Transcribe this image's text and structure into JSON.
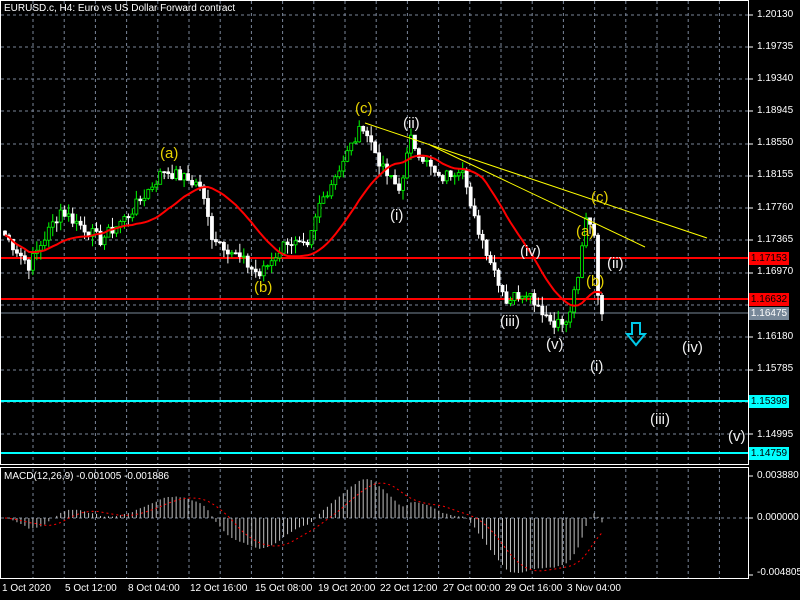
{
  "header": {
    "title": "EURUSD.c, H4:  Euro vs US Dollar Forward contract"
  },
  "price_axis": [
    "1.20130",
    "1.19735",
    "1.19340",
    "1.18945",
    "1.18550",
    "1.18155",
    "1.17760",
    "1.17365",
    "1.16970",
    "1.16180",
    "1.15785",
    "1.14995"
  ],
  "price_tags": {
    "resistance": "1.17153",
    "support1": "1.16632",
    "current": "1.16475",
    "target1": "1.15398",
    "target2": "1.14759"
  },
  "time_axis": [
    "1 Oct 2020",
    "5 Oct 12:00",
    "8 Oct 04:00",
    "12 Oct 16:00",
    "15 Oct 08:00",
    "19 Oct 20:00",
    "22 Oct 12:00",
    "27 Oct 00:00",
    "29 Oct 16:00",
    "3 Nov 04:00"
  ],
  "macd": {
    "label": "MACD(12,26,9) -0.001005 -0.001886",
    "axis": [
      "0.003880",
      "0.000000",
      "-0.004805"
    ]
  },
  "waves": {
    "a1": "(a)",
    "b1": "(b)",
    "c1": "(c)",
    "ii1": "(ii)",
    "i1": "(i)",
    "iii1": "(iii)",
    "iv1": "(iv)",
    "v1": "(v)",
    "a2": "(a)",
    "b2": "(b)",
    "c2": "(c)",
    "ii2": "(ii)",
    "i2": "(i)",
    "iv2": "(iv)",
    "iii2": "(iii)",
    "v2": "(v)"
  },
  "colors": {
    "bull": "#00ff00",
    "bear": "#ffffff",
    "ma": "#ff0000",
    "level": "#ff0000",
    "target": "#00ffff",
    "trend": "#ffff00"
  },
  "chart_data": {
    "type": "candlestick",
    "symbol": "EURUSD.c",
    "timeframe": "H4",
    "ylim": [
      1.1445,
      1.203
    ],
    "keypoints": [
      [
        0,
        1.17439
      ],
      [
        6,
        1.17072
      ],
      [
        14,
        1.17745
      ],
      [
        24,
        1.17378
      ],
      [
        31,
        1.17684
      ],
      [
        40,
        1.18234
      ],
      [
        49,
        1.18051
      ],
      [
        52,
        1.17439
      ],
      [
        64,
        1.1695
      ],
      [
        71,
        1.17378
      ],
      [
        76,
        1.17256
      ],
      [
        79,
        1.17806
      ],
      [
        85,
        1.18357
      ],
      [
        90,
        1.18785
      ],
      [
        95,
        1.18234
      ],
      [
        99,
        1.1799
      ],
      [
        102,
        1.18601
      ],
      [
        109,
        1.18112
      ],
      [
        115,
        1.18295
      ],
      [
        117,
        1.17745
      ],
      [
        121,
        1.17256
      ],
      [
        126,
        1.16644
      ],
      [
        131,
        1.16767
      ],
      [
        137,
        1.164
      ],
      [
        141,
        1.16339
      ],
      [
        144,
        1.16889
      ],
      [
        146,
        1.17684
      ],
      [
        148,
        1.175
      ],
      [
        149,
        1.16644
      ],
      [
        150,
        1.16475
      ]
    ],
    "macd_ylim": [
      -0.004805,
      0.00388
    ]
  }
}
